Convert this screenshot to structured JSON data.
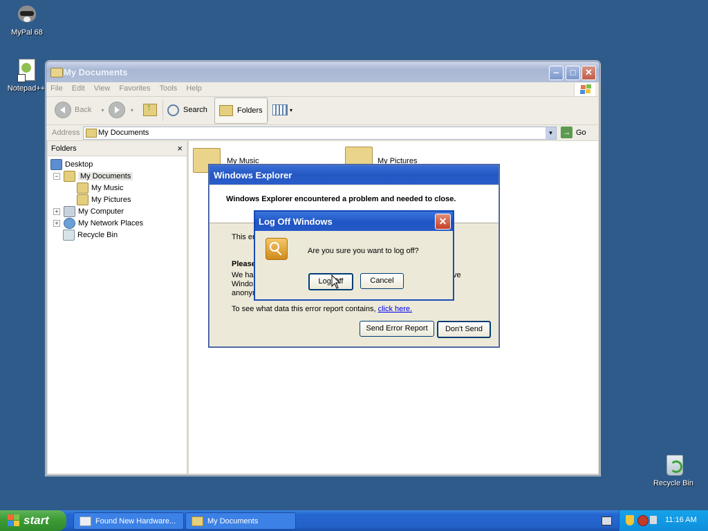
{
  "desktop": {
    "icons": [
      {
        "label": "MyPal 68"
      },
      {
        "label": "Notepad++"
      },
      {
        "label": "Recycle Bin"
      }
    ]
  },
  "explorer": {
    "title": "My Documents",
    "menu": [
      "File",
      "Edit",
      "View",
      "Favorites",
      "Tools",
      "Help"
    ],
    "toolbar": {
      "back": "Back",
      "search": "Search",
      "folders": "Folders"
    },
    "address": {
      "label": "Address",
      "value": "My Documents",
      "go": "Go"
    },
    "folders_pane": {
      "header": "Folders",
      "close": "×",
      "items": [
        "Desktop",
        "My Documents",
        "My Music",
        "My Pictures",
        "My Computer",
        "My Network Places",
        "Recycle Bin"
      ]
    },
    "content_items": [
      "My Music",
      "My Pictures"
    ]
  },
  "error_dialog": {
    "title": "Windows Explorer",
    "message": "Windows Explorer encountered a problem and needed to close.",
    "body_fragment_1": "This er",
    "body_fragment_2": "Please",
    "body_fragment_3": "We ha",
    "body_fragment_4": "Windo",
    "body_fragment_5": "anonyn",
    "body_fragment_6": "ve",
    "see_data_text": "To see what data this error report contains,",
    "click_here": "click here.",
    "send_button": "Send Error Report",
    "dont_send_button": "Don't Send"
  },
  "logoff_dialog": {
    "title": "Log Off Windows",
    "message": "Are you sure you want to log off?",
    "logoff_button": "Log Off",
    "cancel_button": "Cancel"
  },
  "taskbar": {
    "start": "start",
    "tasks": [
      "Found New Hardware...",
      "My Documents"
    ],
    "clock": "11:16 AM"
  }
}
